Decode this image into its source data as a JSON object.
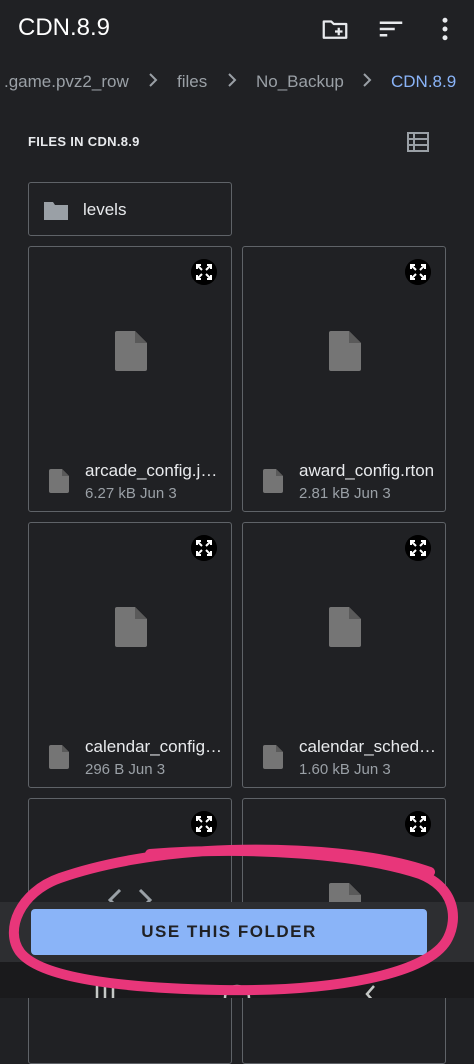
{
  "header": {
    "title": "CDN.8.9",
    "icons": [
      "create-folder-icon",
      "sort-icon",
      "more-vert-icon"
    ]
  },
  "breadcrumb": [
    {
      "label": ".game.pvz2_row"
    },
    {
      "label": "files"
    },
    {
      "label": "No_Backup"
    },
    {
      "label": "CDN.8.9",
      "active": true
    }
  ],
  "section": {
    "title": "FILES IN CDN.8.9",
    "view_icon": "list-view-icon"
  },
  "folders": [
    {
      "name": "levels",
      "icon": "folder-icon"
    }
  ],
  "files": [
    {
      "name": "arcade_config.json",
      "size": "6.27 kB",
      "date": "Jun 3"
    },
    {
      "name": "award_config.rton",
      "size": "2.81 kB",
      "date": "Jun 3"
    },
    {
      "name": "calendar_config.json",
      "size": "296 B",
      "date": "Jun 3"
    },
    {
      "name": "calendar_schedule.json",
      "size": "1.60 kB",
      "date": "Jun 3"
    },
    {
      "name": "",
      "size": "",
      "date": ""
    },
    {
      "name": "",
      "size": "",
      "date": ""
    }
  ],
  "action": {
    "use_folder_label": "USE THIS FOLDER"
  },
  "colors": {
    "background": "#202124",
    "accent": "#8ab4f8",
    "annotation": "#e8367a"
  }
}
